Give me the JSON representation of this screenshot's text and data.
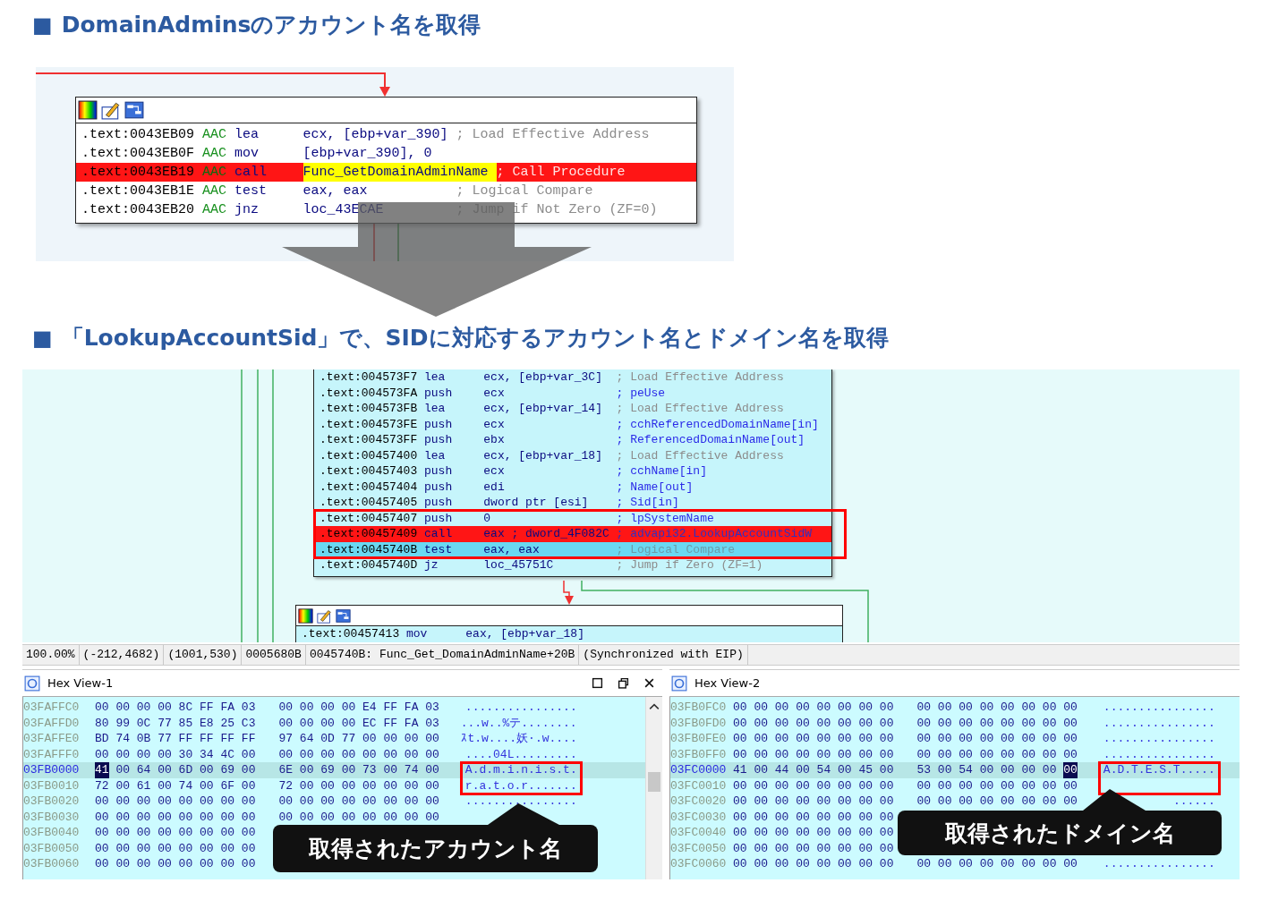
{
  "section_1": {
    "marker": "■",
    "title": "DomainAdminsのアカウント名を取得",
    "block": {
      "rows": [
        {
          "address": ".text:0043EB09",
          "segment": "AAC",
          "mnemonic": "lea",
          "operands": "ecx, [ebp+var_390]",
          "comment": {
            "text": "; Load Effective Address",
            "kind": "auto"
          },
          "breakpoint": false,
          "current": false,
          "marked": false
        },
        {
          "address": ".text:0043EB0F",
          "segment": "AAC",
          "mnemonic": "mov",
          "operands": "[ebp+var_390], 0",
          "breakpoint": false,
          "current": false,
          "marked": false
        },
        {
          "address": ".text:0043EB19",
          "segment": "AAC",
          "mnemonic": "call",
          "operands": "Func_GetDomainAdminName",
          "comment": {
            "text": "; Call Procedure",
            "kind": "auto"
          },
          "breakpoint": true,
          "current": false,
          "marked": true
        },
        {
          "address": ".text:0043EB1E",
          "segment": "AAC",
          "mnemonic": "test",
          "operands": "eax, eax",
          "comment": {
            "text": "; Logical Compare",
            "kind": "auto"
          },
          "breakpoint": false,
          "current": false,
          "marked": false
        },
        {
          "address": ".text:0043EB20",
          "segment": "AAC",
          "mnemonic": "jnz",
          "operands": "loc_43ECAE",
          "comment": {
            "text": "; Jump if Not Zero (ZF=0)",
            "kind": "auto"
          },
          "breakpoint": false,
          "current": false,
          "marked": false
        }
      ]
    }
  },
  "section_2": {
    "marker": "■",
    "title": "「LookupAccountSid」で、SIDに対応するアカウント名とドメイン名を取得",
    "block": {
      "rows": [
        {
          "address": ".text:004573F7",
          "mnemonic": "lea",
          "operands": "ecx, [ebp+var_3C]",
          "comment": {
            "text": "; Load Effective Address",
            "kind": "auto"
          },
          "breakpoint": false,
          "current": false
        },
        {
          "address": ".text:004573FA",
          "mnemonic": "push",
          "operands": "ecx",
          "comment": {
            "text": "; peUse",
            "kind": "arg"
          },
          "breakpoint": false,
          "current": false
        },
        {
          "address": ".text:004573FB",
          "mnemonic": "lea",
          "operands": "ecx, [ebp+var_14]",
          "comment": {
            "text": "; Load Effective Address",
            "kind": "auto"
          },
          "breakpoint": false,
          "current": false
        },
        {
          "address": ".text:004573FE",
          "mnemonic": "push",
          "operands": "ecx",
          "comment": {
            "text": "; cchReferencedDomainName[in]",
            "kind": "arg"
          },
          "breakpoint": false,
          "current": false
        },
        {
          "address": ".text:004573FF",
          "mnemonic": "push",
          "operands": "ebx",
          "comment": {
            "text": "; ReferencedDomainName[out]",
            "kind": "arg"
          },
          "breakpoint": false,
          "current": false
        },
        {
          "address": ".text:00457400",
          "mnemonic": "lea",
          "operands": "ecx, [ebp+var_18]",
          "comment": {
            "text": "; Load Effective Address",
            "kind": "auto"
          },
          "breakpoint": false,
          "current": false
        },
        {
          "address": ".text:00457403",
          "mnemonic": "push",
          "operands": "ecx",
          "comment": {
            "text": "; cchName[in]",
            "kind": "arg"
          },
          "breakpoint": false,
          "current": false
        },
        {
          "address": ".text:00457404",
          "mnemonic": "push",
          "operands": "edi",
          "comment": {
            "text": "; Name[out]",
            "kind": "arg"
          },
          "breakpoint": false,
          "current": false
        },
        {
          "address": ".text:00457405",
          "mnemonic": "push",
          "operands": "dword ptr [esi]",
          "comment": {
            "text": "; Sid[in]",
            "kind": "arg"
          },
          "breakpoint": false,
          "current": false
        },
        {
          "address": ".text:00457407",
          "mnemonic": "push",
          "operands": "0",
          "comment": {
            "text": "; lpSystemName",
            "kind": "arg"
          },
          "breakpoint": false,
          "current": false
        },
        {
          "address": ".text:00457409",
          "mnemonic": "call",
          "operands": "eax ; dword_4F082C",
          "comment": {
            "text": "; advapi32.LookupAccountSidW",
            "kind": "arg"
          },
          "breakpoint": true,
          "current": false
        },
        {
          "address": ".text:0045740B",
          "mnemonic": "test",
          "operands": "eax, eax",
          "comment": {
            "text": "; Logical Compare",
            "kind": "auto"
          },
          "breakpoint": false,
          "current": true
        },
        {
          "address": ".text:0045740D",
          "mnemonic": "jz",
          "operands": "loc_45751C",
          "comment": {
            "text": "; Jump if Zero (ZF=1)",
            "kind": "auto"
          },
          "breakpoint": false,
          "current": false
        }
      ]
    },
    "next_block": {
      "rows": [
        {
          "address": ".text:00457413",
          "mnemonic": "mov",
          "operands": "eax, [ebp+var_18]",
          "breakpoint": false,
          "current": false
        }
      ]
    }
  },
  "status_bar": [
    "100.00%",
    "(-212,4682)",
    "(1001,530)",
    "0005680B",
    "0045740B: Func_Get_DomainAdminName+20B",
    "(Synchronized with EIP)"
  ],
  "hex_views": [
    {
      "title": "Hex View-1",
      "window_controls": true,
      "scrollbar": true,
      "callout": "取得されたアカウント名",
      "rows": [
        {
          "address": "03FAFFC0",
          "groups": [
            "00 00 00 00 8C FF FA 03",
            "00 00 00 00 E4 FF FA 03"
          ],
          "ascii": "................",
          "selected": false
        },
        {
          "address": "03FAFFD0",
          "groups": [
            "80 99 0C 77 85 E8 25 C3",
            "00 00 00 00 EC FF FA 03"
          ],
          "ascii": "...w..%テ........",
          "selected": false
        },
        {
          "address": "03FAFFE0",
          "groups": [
            "BD 74 0B 77 FF FF FF FF",
            "97 64 0D 77 00 00 00 00"
          ],
          "ascii": "ｽt.w....妖·.w....",
          "selected": false
        },
        {
          "address": "03FAFFF0",
          "groups": [
            "00 00 00 00 30 34 4C 00",
            "00 00 00 00 00 00 00 00"
          ],
          "ascii": "....04L.........",
          "selected": false
        },
        {
          "address": "03FB0000",
          "groups": [
            [
              {
                "text": "41",
                "cursor": true
              },
              {
                "text": "00 64 00 6D 00 69 00",
                "cursor": false
              }
            ],
            "6E 00 69 00 73 00 74 00"
          ],
          "ascii": "A.d.m.i.n.i.s.t.",
          "selected": true
        },
        {
          "address": "03FB0010",
          "groups": [
            "72 00 61 00 74 00 6F 00",
            "72 00 00 00 00 00 00 00"
          ],
          "ascii": "r.a.t.o.r.......",
          "selected": false
        },
        {
          "address": "03FB0020",
          "groups": [
            "00 00 00 00 00 00 00 00",
            "00 00 00 00 00 00 00 00"
          ],
          "ascii": "................",
          "selected": false
        },
        {
          "address": "03FB0030",
          "groups": [
            "00 00 00 00 00 00 00 00",
            "00 00 00 00 00 00 00 00"
          ],
          "selected": false
        },
        {
          "address": "03FB0040",
          "groups": [
            "00 00 00 00 00 00 00 00"
          ],
          "selected": false
        },
        {
          "address": "03FB0050",
          "groups": [
            "00 00 00 00 00 00 00 00"
          ],
          "selected": false
        },
        {
          "address": "03FB0060",
          "groups": [
            "00 00 00 00 00 00 00 00"
          ],
          "selected": false
        }
      ]
    },
    {
      "title": "Hex View-2",
      "window_controls": false,
      "scrollbar": false,
      "callout": "取得されたドメイン名",
      "rows": [
        {
          "address": "03FB0FC0",
          "groups": [
            "00 00 00 00 00 00 00 00",
            "00 00 00 00 00 00 00 00"
          ],
          "ascii": "................",
          "selected": false
        },
        {
          "address": "03FB0FD0",
          "groups": [
            "00 00 00 00 00 00 00 00",
            "00 00 00 00 00 00 00 00"
          ],
          "ascii": "................",
          "selected": false
        },
        {
          "address": "03FB0FE0",
          "groups": [
            "00 00 00 00 00 00 00 00",
            "00 00 00 00 00 00 00 00"
          ],
          "ascii": "................",
          "selected": false
        },
        {
          "address": "03FB0FF0",
          "groups": [
            "00 00 00 00 00 00 00 00",
            "00 00 00 00 00 00 00 00"
          ],
          "ascii": "................",
          "selected": false
        },
        {
          "address": "03FC0000",
          "groups": [
            "41 00 44 00 54 00 45 00",
            [
              {
                "text": "53 00 54 00 00 00 00",
                "cursor": false
              },
              {
                "text": "00",
                "cursor": true
              }
            ]
          ],
          "ascii": "A.D.T.E.S.T.....",
          "selected": true
        },
        {
          "address": "03FC0010",
          "groups": [
            "00 00 00 00 00 00 00 00",
            "00 00 00 00 00 00 00 00"
          ],
          "selected": false
        },
        {
          "address": "03FC0020",
          "groups": [
            "00 00 00 00 00 00 00 00",
            "00 00 00 00 00 00 00 00"
          ],
          "ascii": "......",
          "selected": false
        },
        {
          "address": "03FC0030",
          "groups": [
            "00 00 00 00 00 00 00 00"
          ],
          "selected": false
        },
        {
          "address": "03FC0040",
          "groups": [
            "00 00 00 00 00 00 00 00"
          ],
          "selected": false
        },
        {
          "address": "03FC0050",
          "groups": [
            "00 00 00 00 00 00 00 00"
          ],
          "selected": false
        },
        {
          "address": "03FC0060",
          "groups": [
            "00 00 00 00 00 00 00 00",
            "00 00 00 00 00 00 00 00"
          ],
          "ascii": "................",
          "selected": false
        }
      ]
    }
  ]
}
